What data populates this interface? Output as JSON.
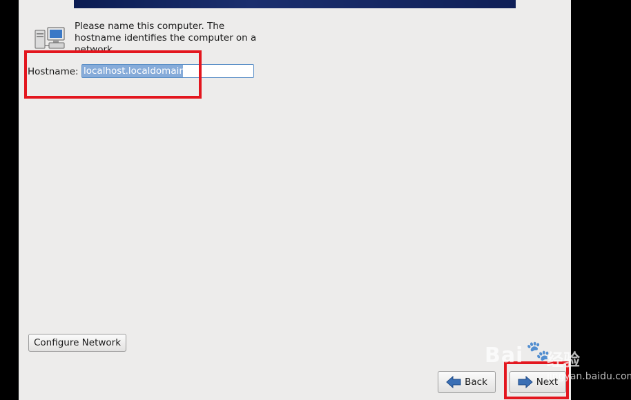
{
  "header": {
    "description": "Please name this computer.  The hostname identifies the computer on a network."
  },
  "hostname": {
    "label": "Hostname:",
    "value": "localhost.localdomain"
  },
  "buttons": {
    "configure_network": "Configure Network",
    "back": "Back",
    "next": "Next"
  },
  "icons": {
    "network": "network-computers-icon",
    "back": "back-arrow-icon",
    "next": "next-arrow-icon"
  },
  "watermark": {
    "text1": "Bai",
    "paw": "🐾",
    "text2": "经验",
    "url": "jingyan.baidu.com"
  },
  "colors": {
    "annotation": "#e3161e",
    "banner": "#0b1c52",
    "background": "#edeceb",
    "arrow": "#3a6fb5"
  }
}
